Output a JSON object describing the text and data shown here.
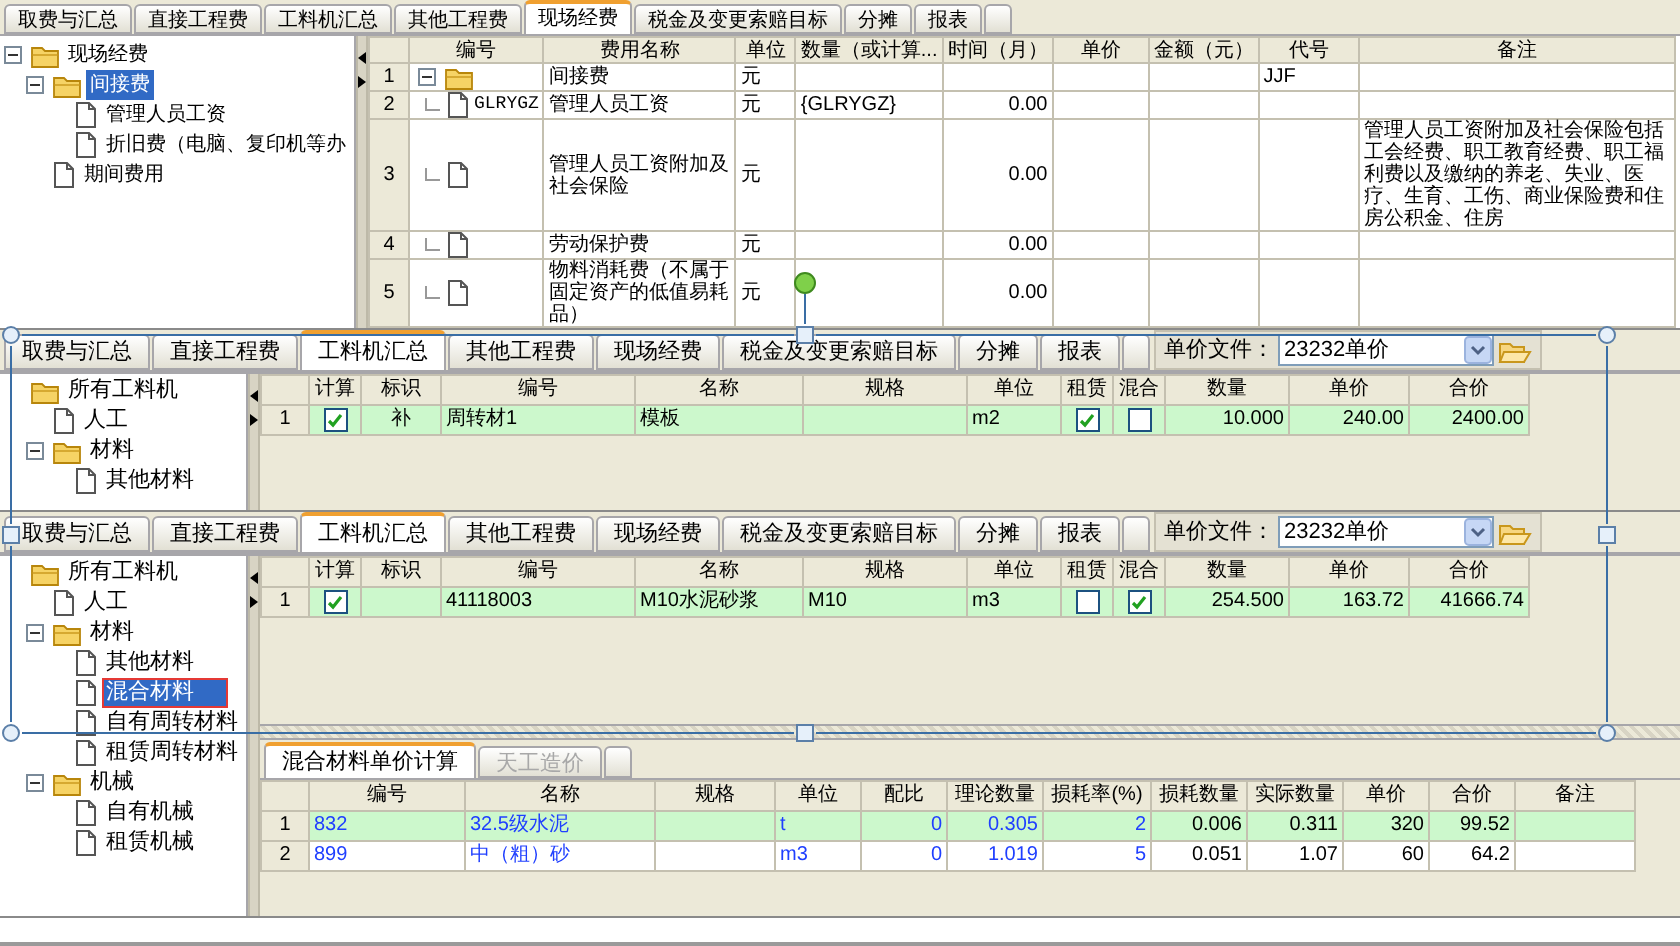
{
  "panels": [
    {
      "kind": "fees",
      "tabs": [
        {
          "label": "取费与汇总",
          "selected": false
        },
        {
          "label": "直接工程费",
          "selected": false
        },
        {
          "label": "工料机汇总",
          "selected": false
        },
        {
          "label": "其他工程费",
          "selected": false
        },
        {
          "label": "现场经费",
          "selected": true
        },
        {
          "label": "税金及变更索赔目标",
          "selected": false
        },
        {
          "label": "分摊",
          "selected": false
        },
        {
          "label": "报表",
          "selected": false
        }
      ],
      "tree": [
        {
          "label": "现场经费",
          "kind": "folder",
          "expanded": true,
          "selected": false,
          "children": [
            {
              "label": "间接费",
              "kind": "folder",
              "expanded": true,
              "selected": true,
              "children": [
                {
                  "label": "管理人员工资",
                  "kind": "file",
                  "selected": false
                },
                {
                  "label": "折旧费（电脑、复印机等办",
                  "kind": "file",
                  "selected": false
                }
              ]
            },
            {
              "label": "期间费用",
              "kind": "file",
              "selected": false
            }
          ]
        }
      ],
      "grid": {
        "columns": [
          {
            "label": "编号",
            "kind": "tree"
          },
          {
            "label": "费用名称",
            "kind": "text"
          },
          {
            "label": "单位",
            "kind": "text"
          },
          {
            "label": "数量（或计算...",
            "kind": "text"
          },
          {
            "label": "时间（月）",
            "kind": "number"
          },
          {
            "label": "单价",
            "kind": "number"
          },
          {
            "label": "金额（元）",
            "kind": "number"
          },
          {
            "label": "代号",
            "kind": "text"
          },
          {
            "label": "备注",
            "kind": "text"
          }
        ],
        "rows": [
          {
            "num": "1",
            "selected": false,
            "kind": "folder",
            "expanded": true,
            "cells": [
              null,
              "间接费",
              "元",
              null,
              null,
              null,
              null,
              "JJF",
              null
            ]
          },
          {
            "num": "2",
            "selected": false,
            "kind": "file",
            "cells": [
              "GLRYGZ",
              "管理人员工资",
              "元",
              "{GLRYGZ}",
              "0.00",
              null,
              null,
              null,
              null
            ]
          },
          {
            "num": "3",
            "selected": false,
            "kind": "file",
            "cells": [
              null,
              "管理人员工资附加及社会保险",
              "元",
              null,
              "0.00",
              null,
              null,
              null,
              "管理人员工资附加及社会保险包括工会经费、职工教育经费、职工福利费以及缴纳的养老、失业、医疗、生育、工伤、商业保险费和住房公积金、住房"
            ]
          },
          {
            "num": "4",
            "selected": false,
            "kind": "file",
            "cells": [
              null,
              "劳动保护费",
              "元",
              null,
              "0.00",
              null,
              null,
              null,
              null
            ]
          },
          {
            "num": "5",
            "selected": false,
            "kind": "file",
            "cells": [
              null,
              "物料消耗费（不属于固定资产的低值易耗品）",
              "元",
              null,
              "0.00",
              null,
              null,
              null,
              null
            ]
          }
        ]
      }
    },
    {
      "kind": "materials",
      "tabs": [
        {
          "label": "取费与汇总",
          "selected": false
        },
        {
          "label": "直接工程费",
          "selected": false
        },
        {
          "label": "工料机汇总",
          "selected": true
        },
        {
          "label": "其他工程费",
          "selected": false
        },
        {
          "label": "现场经费",
          "selected": false
        },
        {
          "label": "税金及变更索赔目标",
          "selected": false
        },
        {
          "label": "分摊",
          "selected": false
        },
        {
          "label": "报表",
          "selected": false
        }
      ],
      "price_file": {
        "label": "单价文件：",
        "value": "23232单价"
      },
      "tree": [
        {
          "label": "所有工料机",
          "kind": "folder",
          "selected": false,
          "children": [
            {
              "label": "人工",
              "kind": "file",
              "selected": false
            },
            {
              "label": "材料",
              "kind": "folder",
              "expanded": true,
              "selected": false,
              "children": [
                {
                  "label": "其他材料",
                  "kind": "file",
                  "selected": false
                }
              ]
            }
          ]
        }
      ],
      "grid": {
        "columns": [
          {
            "label": "计算",
            "kind": "check"
          },
          {
            "label": "标识",
            "kind": "center"
          },
          {
            "label": "编号",
            "kind": "text"
          },
          {
            "label": "名称",
            "kind": "text"
          },
          {
            "label": "规格",
            "kind": "text"
          },
          {
            "label": "单位",
            "kind": "text"
          },
          {
            "label": "租赁",
            "kind": "check"
          },
          {
            "label": "混合",
            "kind": "check"
          },
          {
            "label": "数量",
            "kind": "number"
          },
          {
            "label": "单价",
            "kind": "number"
          },
          {
            "label": "合价",
            "kind": "number"
          }
        ],
        "rows": [
          {
            "num": "1",
            "selected": true,
            "cells": [
              {
                "checked": true
              },
              "补",
              "周转材1",
              "模板",
              null,
              "m2",
              {
                "checked": true
              },
              {
                "checked": false
              },
              "10.000",
              "240.00",
              "2400.00"
            ]
          }
        ]
      }
    },
    {
      "kind": "materials",
      "tabs": [
        {
          "label": "取费与汇总",
          "selected": false
        },
        {
          "label": "直接工程费",
          "selected": false
        },
        {
          "label": "工料机汇总",
          "selected": true
        },
        {
          "label": "其他工程费",
          "selected": false
        },
        {
          "label": "现场经费",
          "selected": false
        },
        {
          "label": "税金及变更索赔目标",
          "selected": false
        },
        {
          "label": "分摊",
          "selected": false
        },
        {
          "label": "报表",
          "selected": false
        }
      ],
      "price_file": {
        "label": "单价文件：",
        "value": "23232单价"
      },
      "tree": [
        {
          "label": "所有工料机",
          "kind": "folder",
          "selected": false,
          "children": [
            {
              "label": "人工",
              "kind": "file",
              "selected": false
            },
            {
              "label": "材料",
              "kind": "folder",
              "expanded": true,
              "selected": false,
              "children": [
                {
                  "label": "其他材料",
                  "kind": "file",
                  "selected": false
                },
                {
                  "label": "混合材料",
                  "kind": "file",
                  "selected": true,
                  "marked": true
                },
                {
                  "label": "自有周转材料",
                  "kind": "file",
                  "selected": false
                },
                {
                  "label": "租赁周转材料",
                  "kind": "file",
                  "selected": false
                }
              ]
            },
            {
              "label": "机械",
              "kind": "folder",
              "expanded": true,
              "selected": false,
              "children": [
                {
                  "label": "自有机械",
                  "kind": "file",
                  "selected": false
                },
                {
                  "label": "租赁机械",
                  "kind": "file",
                  "selected": false
                }
              ]
            }
          ]
        }
      ],
      "grid": {
        "columns": [
          {
            "label": "计算",
            "kind": "check"
          },
          {
            "label": "标识",
            "kind": "center"
          },
          {
            "label": "编号",
            "kind": "text"
          },
          {
            "label": "名称",
            "kind": "text"
          },
          {
            "label": "规格",
            "kind": "text"
          },
          {
            "label": "单位",
            "kind": "text"
          },
          {
            "label": "租赁",
            "kind": "check"
          },
          {
            "label": "混合",
            "kind": "check"
          },
          {
            "label": "数量",
            "kind": "number"
          },
          {
            "label": "单价",
            "kind": "number"
          },
          {
            "label": "合价",
            "kind": "number"
          }
        ],
        "rows": [
          {
            "num": "1",
            "selected": true,
            "cells": [
              {
                "checked": true
              },
              null,
              "41118003",
              "M10水泥砂浆",
              "M10",
              "m3",
              {
                "checked": false
              },
              {
                "checked": true
              },
              "254.500",
              "163.72",
              "41666.74"
            ]
          }
        ]
      },
      "sub_tabs": [
        {
          "label": "混合材料单价计算",
          "selected": true,
          "disabled": false
        },
        {
          "label": "天工造价",
          "selected": false,
          "disabled": true
        }
      ],
      "sub_grid": {
        "columns": [
          {
            "label": "编号",
            "kind": "text",
            "editable": true,
            "cells": [
              "832",
              "899"
            ]
          },
          {
            "label": "名称",
            "kind": "text",
            "editable": true,
            "cells": [
              "32.5级水泥",
              "中（粗）砂"
            ]
          },
          {
            "label": "规格",
            "kind": "text",
            "cells": [
              null,
              null
            ]
          },
          {
            "label": "单位",
            "kind": "text",
            "editable": true,
            "cells": [
              "t",
              "m3"
            ]
          },
          {
            "label": "配比",
            "kind": "number",
            "editable": true,
            "cells": [
              "0",
              "0"
            ]
          },
          {
            "label": "理论数量",
            "kind": "number",
            "editable": true,
            "cells": [
              "0.305",
              "1.019"
            ]
          },
          {
            "label": "损耗率(%)",
            "kind": "number",
            "editable": true,
            "cells": [
              "2",
              "5"
            ]
          },
          {
            "label": "损耗数量",
            "kind": "number",
            "editable": false,
            "cells": [
              "0.006",
              "0.051"
            ]
          },
          {
            "label": "实际数量",
            "kind": "number",
            "editable": false,
            "cells": [
              "0.311",
              "1.07"
            ]
          },
          {
            "label": "单价",
            "kind": "number",
            "editable": false,
            "cells": [
              "320",
              "60"
            ]
          },
          {
            "label": "合价",
            "kind": "number",
            "editable": false,
            "cells": [
              "99.52",
              "64.2"
            ]
          },
          {
            "label": "备注",
            "kind": "text",
            "cells": [
              null,
              null
            ]
          }
        ],
        "rows": [
          {
            "num": "1",
            "selected": true
          },
          {
            "num": "2",
            "selected": false
          }
        ]
      }
    }
  ]
}
